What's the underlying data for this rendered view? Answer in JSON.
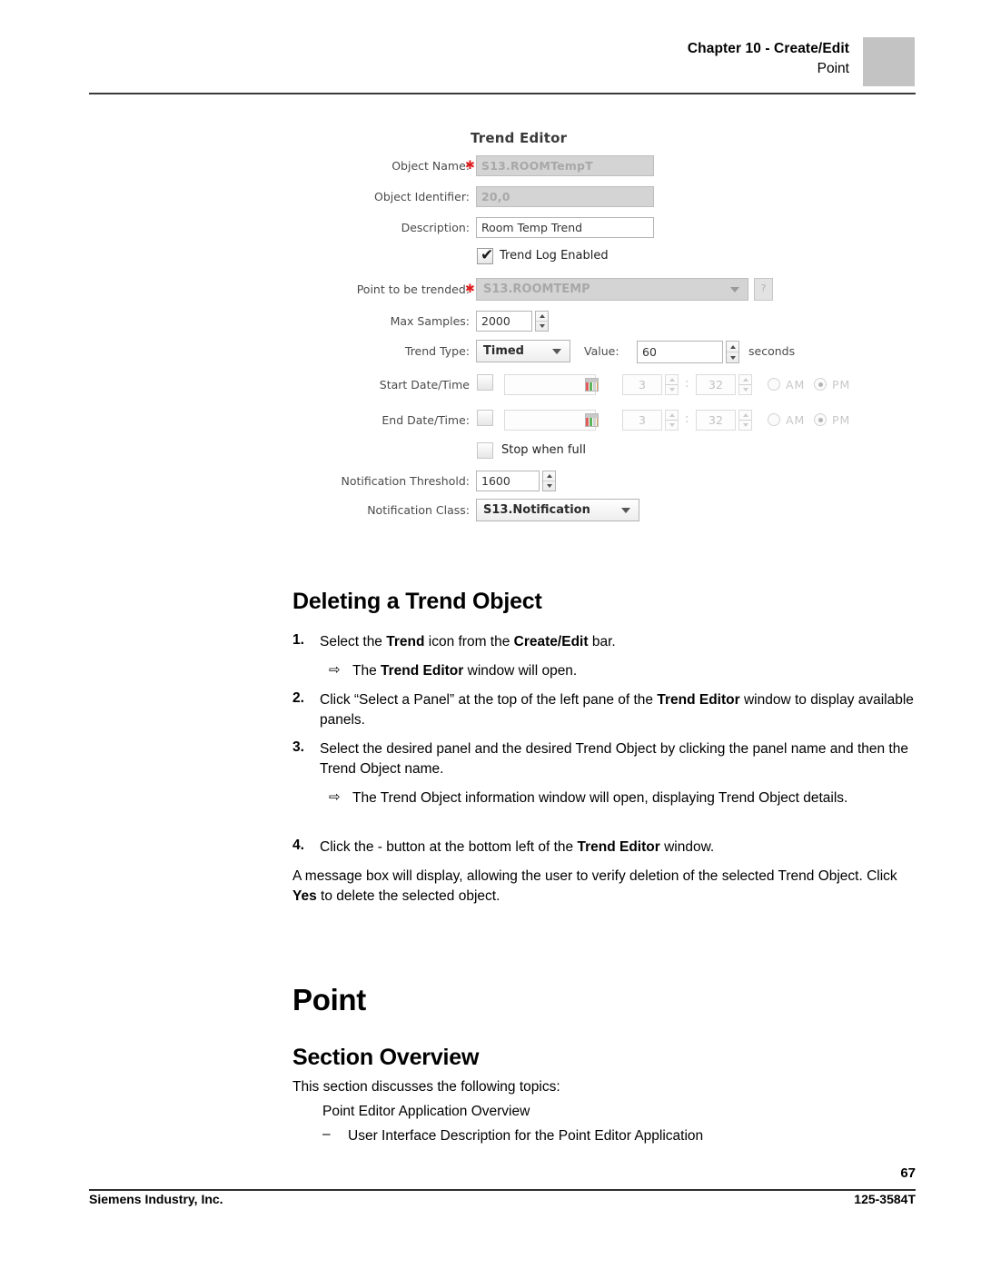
{
  "header": {
    "chapter": "Chapter 10 - Create/Edit",
    "section": "Point"
  },
  "figure": {
    "title": "Trend Editor",
    "fields": {
      "object_name": {
        "label": "Object Name:",
        "value": "S13.ROOMTempT",
        "required_marker": "✱"
      },
      "object_identifier": {
        "label": "Object Identifier:",
        "value": "20,0"
      },
      "description": {
        "label": "Description:",
        "value": "Room Temp Trend"
      },
      "trend_log_enabled": {
        "label": "Trend Log Enabled",
        "checked": true,
        "check_glyph": "✔"
      },
      "point_to_be_trended": {
        "label": "Point to be trended:",
        "value": "S13.ROOMTEMP",
        "required_marker": "✱",
        "help_label": "?"
      },
      "max_samples": {
        "label": "Max Samples:",
        "value": "2000"
      },
      "trend_type": {
        "label": "Trend Type:",
        "value": "Timed"
      },
      "trend_value": {
        "label": "Value:",
        "value": "60",
        "unit": "seconds"
      },
      "start_datetime": {
        "label": "Start Date/Time",
        "date": "",
        "hour": "3",
        "minute": "32",
        "separator": ":",
        "am_label": "AM",
        "pm_label": "PM",
        "meridiem": "PM"
      },
      "end_datetime": {
        "label": "End Date/Time:",
        "date": "",
        "hour": "3",
        "minute": "32",
        "separator": ":",
        "am_label": "AM",
        "pm_label": "PM",
        "meridiem": "PM"
      },
      "stop_when_full": {
        "label": "Stop when full",
        "checked": false
      },
      "notification_threshold": {
        "label": "Notification Threshold:",
        "value": "1600"
      },
      "notification_class": {
        "label": "Notification Class:",
        "value": "S13.Notification"
      }
    }
  },
  "sections": {
    "deleting_trend_object": {
      "heading": "Deleting a Trend Object",
      "steps": [
        {
          "number": "1.",
          "text_html": "Select the <b>Trend</b> icon from the <b>Create/Edit</b> bar."
        },
        {
          "number": "2.",
          "text_html": "Click “Select a Panel” at the top of the left pane of the <b>Trend Editor</b> window to display available panels."
        },
        {
          "number": "3.",
          "text_html": "Select the desired panel and the desired Trend Object by clicking the panel name and then the Trend Object name."
        },
        {
          "number": "4.",
          "text_html": "Click the - button at the bottom left of the <b>Trend Editor</b> window."
        }
      ],
      "result_1_html": "The <b>Trend Editor</b> window will open.",
      "result_2_html": "The Trend Object information window will open, displaying Trend Object details.",
      "closing_html": "A message box will display, allowing the user to verify deletion of the selected Trend Object. Click <b>Yes</b> to delete the selected object.",
      "arrow_glyph": "⇨"
    },
    "point": {
      "heading": "Point",
      "overview_heading": "Section Overview",
      "intro": "This section discusses the following topics:",
      "topics": [
        {
          "text": "Point Editor Application Overview",
          "marker": ""
        },
        {
          "text": "User Interface Description for the Point Editor Application",
          "marker": "–"
        }
      ]
    }
  },
  "footer": {
    "page_number": "67",
    "company": "Siemens Industry, Inc.",
    "doc_number": "125-3584T"
  }
}
